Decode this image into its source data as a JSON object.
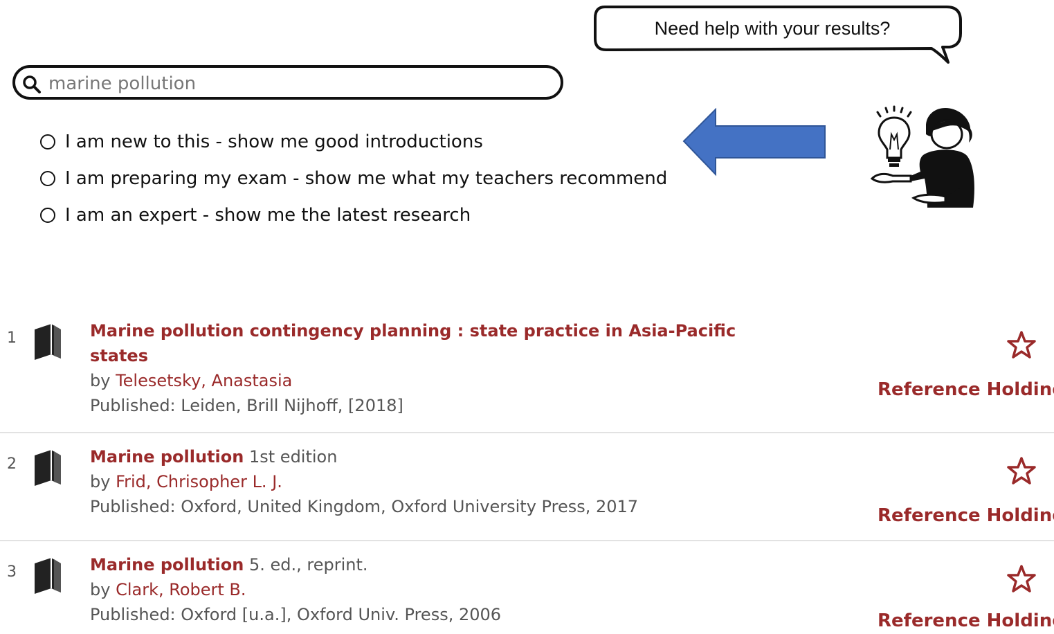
{
  "help": {
    "bubble_text": "Need help with your results?"
  },
  "search": {
    "value": "marine pollution",
    "placeholder": "marine pollution"
  },
  "options": [
    {
      "label": "I am new to this - show me good introductions"
    },
    {
      "label": "I am preparing my exam - show me what my teachers recommend"
    },
    {
      "label": "I am an expert - show me the latest research"
    }
  ],
  "icons": {
    "search": "search-icon",
    "arrow": "arrow-left-icon",
    "guide": "person-with-lightbulb-icon",
    "book": "book-icon",
    "favorite": "star-icon"
  },
  "colors": {
    "accent": "#9a2a2a",
    "arrow": "#4472c4"
  },
  "results": [
    {
      "num": "1",
      "title": "Marine pollution contingency planning : state practice in Asia-Pacific states",
      "suffix": "",
      "by": "by",
      "author": "Telesetsky, Anastasia",
      "published": "Published: Leiden, Brill Nijhoff, [2018]",
      "action": "Reference Holding"
    },
    {
      "num": "2",
      "title": "Marine pollution",
      "suffix": "1st edition",
      "by": "by",
      "author": "Frid, Chrisopher L. J.",
      "published": "Published: Oxford, United Kingdom, Oxford University Press, 2017",
      "action": "Reference Holding"
    },
    {
      "num": "3",
      "title": "Marine pollution",
      "suffix": "5. ed., reprint.",
      "by": "by",
      "author": "Clark, Robert B.",
      "published": "Published: Oxford [u.a.], Oxford Univ. Press, 2006",
      "action": "Reference Holding"
    }
  ]
}
